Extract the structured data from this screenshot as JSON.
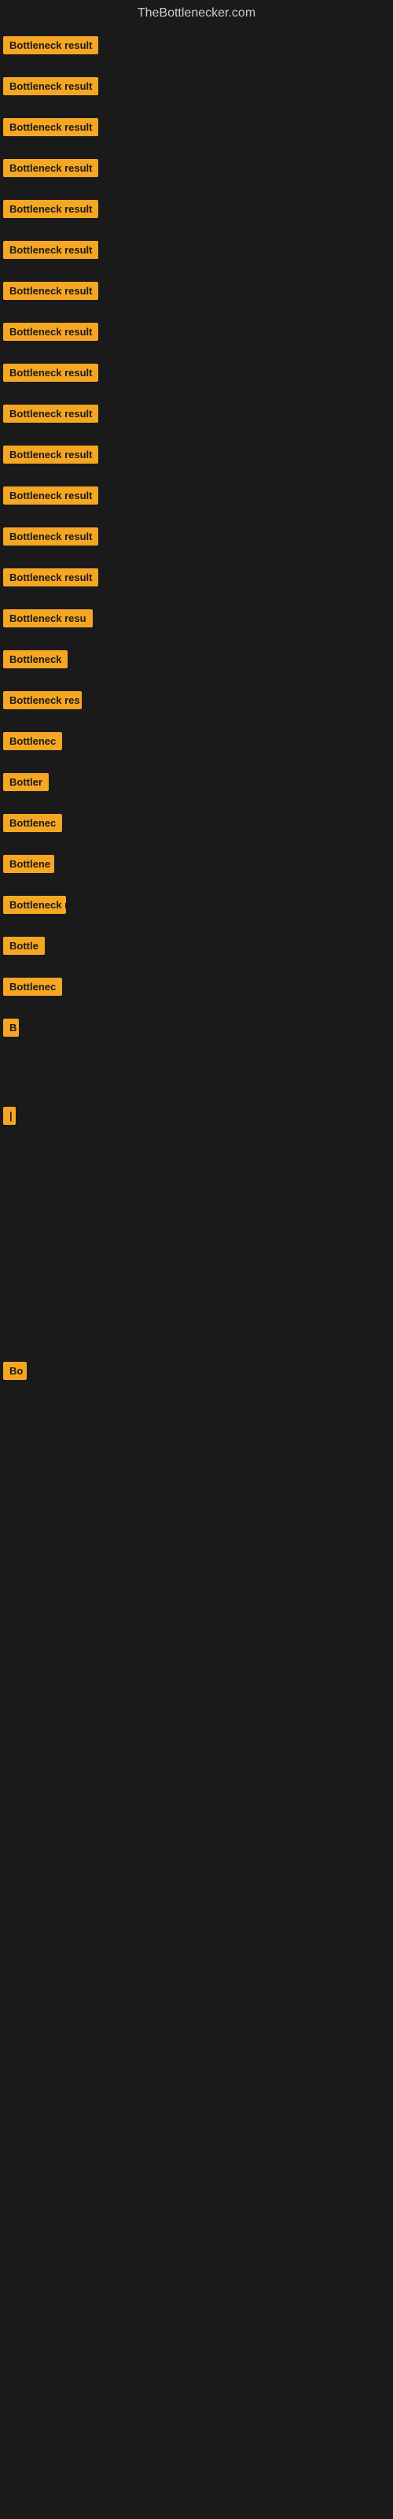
{
  "site": {
    "title": "TheBottlenecker.com"
  },
  "items": [
    {
      "id": 0,
      "label": "Bottleneck result"
    },
    {
      "id": 1,
      "label": "Bottleneck result"
    },
    {
      "id": 2,
      "label": "Bottleneck result"
    },
    {
      "id": 3,
      "label": "Bottleneck result"
    },
    {
      "id": 4,
      "label": "Bottleneck result"
    },
    {
      "id": 5,
      "label": "Bottleneck result"
    },
    {
      "id": 6,
      "label": "Bottleneck result"
    },
    {
      "id": 7,
      "label": "Bottleneck result"
    },
    {
      "id": 8,
      "label": "Bottleneck result"
    },
    {
      "id": 9,
      "label": "Bottleneck result"
    },
    {
      "id": 10,
      "label": "Bottleneck result"
    },
    {
      "id": 11,
      "label": "Bottleneck result"
    },
    {
      "id": 12,
      "label": "Bottleneck result"
    },
    {
      "id": 13,
      "label": "Bottleneck result"
    },
    {
      "id": 14,
      "label": "Bottleneck resu"
    },
    {
      "id": 15,
      "label": "Bottleneck"
    },
    {
      "id": 16,
      "label": "Bottleneck res"
    },
    {
      "id": 17,
      "label": "Bottlenec"
    },
    {
      "id": 18,
      "label": "Bottler"
    },
    {
      "id": 19,
      "label": "Bottlenec"
    },
    {
      "id": 20,
      "label": "Bottlene"
    },
    {
      "id": 21,
      "label": "Bottleneck r"
    },
    {
      "id": 22,
      "label": "Bottle"
    },
    {
      "id": 23,
      "label": "Bottlenec"
    },
    {
      "id": 24,
      "label": "B"
    },
    {
      "id": 25,
      "label": "|"
    },
    {
      "id": 26,
      "label": ""
    },
    {
      "id": 27,
      "label": ""
    },
    {
      "id": 28,
      "label": ""
    },
    {
      "id": 29,
      "label": "Bo"
    }
  ]
}
